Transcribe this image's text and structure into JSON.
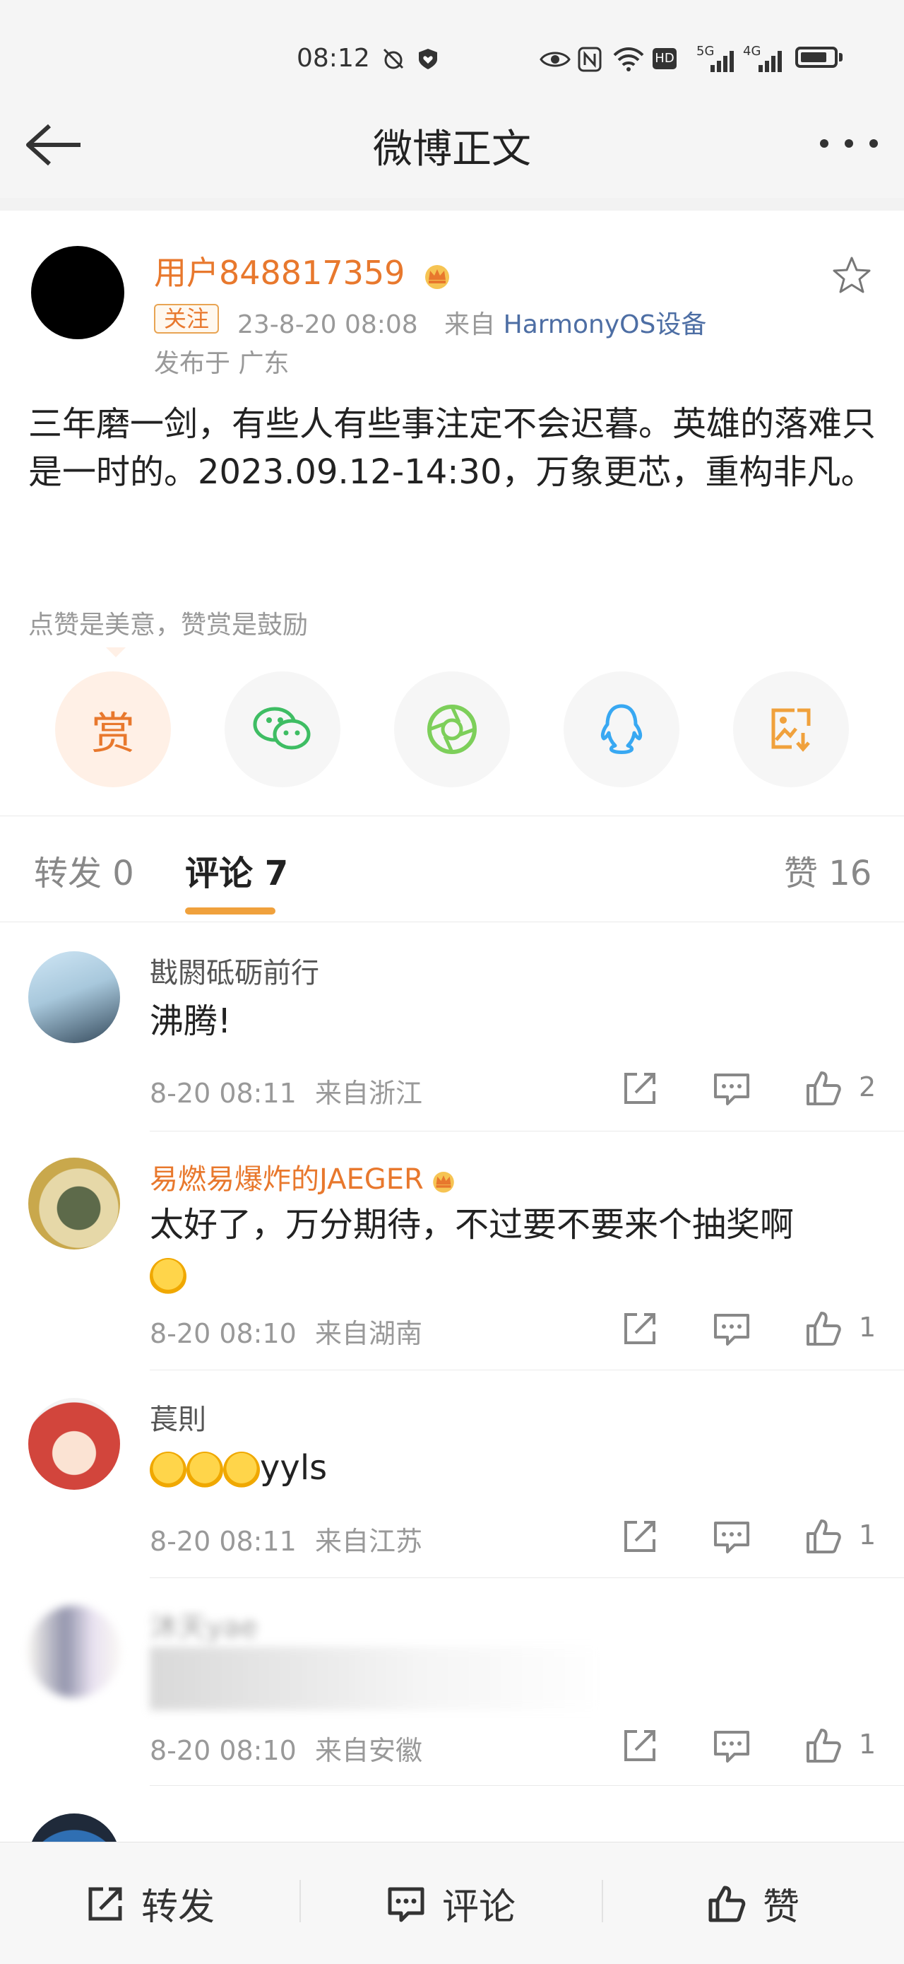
{
  "status_bar": {
    "time": "08:12",
    "icons": [
      "alarm-off-icon",
      "heart-shield-icon",
      "eye-icon",
      "nfc-icon",
      "wifi-icon",
      "hd-icon",
      "signal-5g-icon",
      "signal-4g-icon",
      "battery-icon"
    ],
    "network_labels": [
      "HD",
      "5G",
      "4G"
    ]
  },
  "nav": {
    "title": "微博正文",
    "back_icon": "arrow-left-icon",
    "more_icon": "more-horizontal-icon"
  },
  "post": {
    "username": "用户848817359",
    "follow_label": "关注",
    "time": "23-8-20 08:08",
    "source_prefix": "来自",
    "source": "HarmonyOS设备",
    "location": "发布于 广东",
    "text": "三年磨一剑，有些人有些事注定不会迟暮。英雄的落难只是一时的。2023.09.12-14:30，万象更芯，重构非凡。",
    "reward_hint": "点赞是美意，赞赏是鼓励",
    "reward_label": "赏"
  },
  "share_targets": [
    "reward-icon",
    "wechat-icon",
    "moments-icon",
    "qq-icon",
    "save-image-icon"
  ],
  "colors": {
    "accent": "#e8782d",
    "tab_underline": "#f0a13c",
    "link": "#4d6ea4",
    "wechat": "#3ebd63",
    "qq": "#38a8f2"
  },
  "tabs": {
    "repost": "转发 0",
    "comments": "评论 7",
    "likes": "赞 16"
  },
  "comments": [
    {
      "name": "戡閼砥砺前行",
      "text": "沸腾!",
      "time": "8-20 08:11",
      "from": "来自浙江",
      "likes": "2",
      "vip": false
    },
    {
      "name": "易燃易爆炸的JAEGER",
      "text": "太好了，万分期待，不过要不要来个抽奖啊",
      "time": "8-20 08:10",
      "from": "来自湖南",
      "likes": "1",
      "vip": true
    },
    {
      "name": "萇則",
      "text": "yyls",
      "time": "8-20 08:11",
      "from": "来自江苏",
      "likes": "1",
      "vip": false
    },
    {
      "name": "沐天yae",
      "text": "",
      "time": "8-20 08:10",
      "from": "来自安徽",
      "likes": "1",
      "vip": false
    }
  ],
  "bottom_bar": {
    "repost": "转发",
    "comment": "评论",
    "like": "赞"
  }
}
